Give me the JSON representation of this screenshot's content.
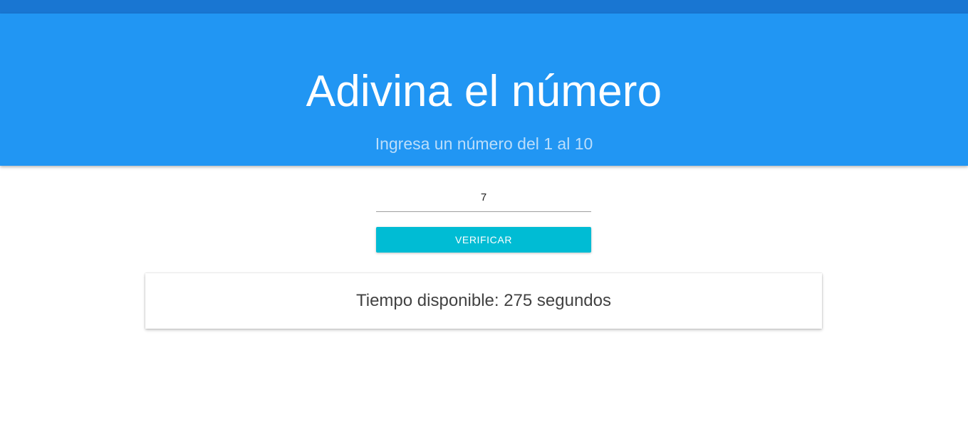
{
  "header": {
    "title": "Adivina el número",
    "subtitle": "Ingresa un número del 1 al 10"
  },
  "form": {
    "guess_value": "7",
    "verify_label": "VERIFICAR"
  },
  "timer": {
    "text": "Tiempo disponible: 275 segundos"
  },
  "colors": {
    "status_bar": "#1976d2",
    "hero": "#2196f3",
    "subtitle": "#bbdefb",
    "button": "#00bcd4"
  }
}
